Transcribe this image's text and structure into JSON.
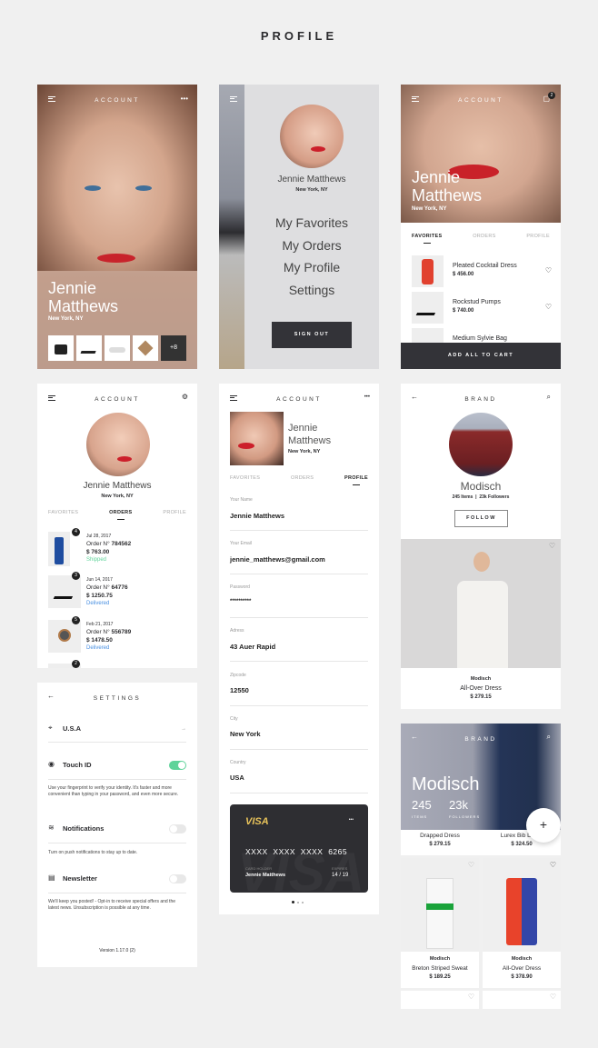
{
  "page_title": "PROFILE",
  "colors": {
    "accent_green": "#5fd39a",
    "delivered_blue": "#4a90e2",
    "dark": "#2e2e32",
    "visa_gold": "#e8c35a"
  },
  "screen1": {
    "header": "ACCOUNT",
    "name_line1": "Jennie",
    "name_line2": "Matthews",
    "location": "New York, NY",
    "more_count": "+8",
    "icons": [
      "menu-icon",
      "more-icon"
    ]
  },
  "screen2": {
    "name": "Jennie Matthews",
    "location": "New York, NY",
    "menu": [
      "My Favorites",
      "My Orders",
      "My Profile",
      "Settings"
    ],
    "sign_out": "SIGN OUT"
  },
  "screen3": {
    "header": "ACCOUNT",
    "cart_count": "2",
    "name_line1": "Jennie",
    "name_line2": "Matthews",
    "location": "New York, NY",
    "tabs": [
      "FAVORITES",
      "ORDERS",
      "PROFILE"
    ],
    "favorites": [
      {
        "name": "Pleated Cocktail Dress",
        "price": "$ 456.00"
      },
      {
        "name": "Rockstud Pumps",
        "price": "$ 740.00"
      },
      {
        "name": "Medium Sylvie Bag",
        "price": ""
      }
    ],
    "cta": "ADD ALL TO CART"
  },
  "screen4": {
    "header": "ACCOUNT",
    "name": "Jennie Matthews",
    "location": "New York, NY",
    "tabs": [
      "FAVORITES",
      "ORDERS",
      "PROFILE"
    ],
    "orders": [
      {
        "badge": "4",
        "date": "Jul 28, 2017",
        "order_label": "Order N°",
        "order_no": "784562",
        "price": "$ 763.00",
        "status": "Shipped"
      },
      {
        "badge": "3",
        "date": "Jun 14, 2017",
        "order_label": "Order N°",
        "order_no": "64776",
        "price": "$ 1250.75",
        "status": "Delivered"
      },
      {
        "badge": "5",
        "date": "Feb 21, 2017",
        "order_label": "Order N°",
        "order_no": "556789",
        "price": "$ 1478.50",
        "status": "Delivered"
      },
      {
        "badge": "2",
        "date": "",
        "order_label": "",
        "order_no": "",
        "price": "",
        "status": ""
      }
    ]
  },
  "settings": {
    "header": "SETTINGS",
    "country": "U.S.A",
    "touch_id": "Touch ID",
    "touch_id_on": true,
    "touch_id_desc": "Use your fingerprint to verify your identity. It's faster and more convenient than typing in your password, and even more secure.",
    "notifications": "Notifications",
    "notifications_on": false,
    "notifications_desc": "Turn on push notifications to stay up to date.",
    "newsletter": "Newsletter",
    "newsletter_on": false,
    "newsletter_desc": "We'll keep you posted! - Opt-in to receive special offers and the latest news. Unsubscription is possible at any time.",
    "version": "Version 1.17.0 (2)"
  },
  "profile": {
    "header": "ACCOUNT",
    "name_line1": "Jennie",
    "name_line2": "Matthews",
    "location": "New York, NY",
    "tabs": [
      "FAVORITES",
      "ORDERS",
      "PROFILE"
    ],
    "fields": [
      {
        "label": "Your Name",
        "value": "Jennie Matthews"
      },
      {
        "label": "Your Email",
        "value": "jennie_matthews@gmail.com"
      },
      {
        "label": "Password",
        "value": "**********"
      },
      {
        "label": "Adress",
        "value": "43 Auer Rapid"
      },
      {
        "label": "Zipcode",
        "value": "12550"
      },
      {
        "label": "City",
        "value": "New York"
      },
      {
        "label": "Country",
        "value": "USA"
      }
    ],
    "card": {
      "brand": "VISA",
      "number": "XXXX  XXXX  XXXX  6265",
      "holder_label": "CARD HOLDER",
      "holder": "Jennie Matthews",
      "expires_label": "EXPIRES",
      "expires": "14 / 19"
    },
    "pager_active": 1,
    "pager_total": 3
  },
  "brand": {
    "header": "BRAND",
    "name": "Modisch",
    "stats": "245 Items  |  23k Followers",
    "follow": "FOLLOW",
    "product": {
      "brand": "Modisch",
      "name": "All-Over Dress",
      "price": "$ 279.15"
    }
  },
  "brand2": {
    "header": "BRAND",
    "name": "Modisch",
    "items": "245",
    "items_label": "ITEMS",
    "followers": "23k",
    "followers_label": "FOLLOWERS",
    "top_products": [
      {
        "name": "Drapped Dress",
        "price": "$ 279.15"
      },
      {
        "name": "Lurex Bib Dress",
        "price": "$ 324.50"
      }
    ],
    "products": [
      {
        "brand": "Modisch",
        "name": "Breton Striped Sweat",
        "price": "$ 189.25"
      },
      {
        "brand": "Modisch",
        "name": "All-Over Dress",
        "price": "$ 378.90"
      }
    ]
  }
}
